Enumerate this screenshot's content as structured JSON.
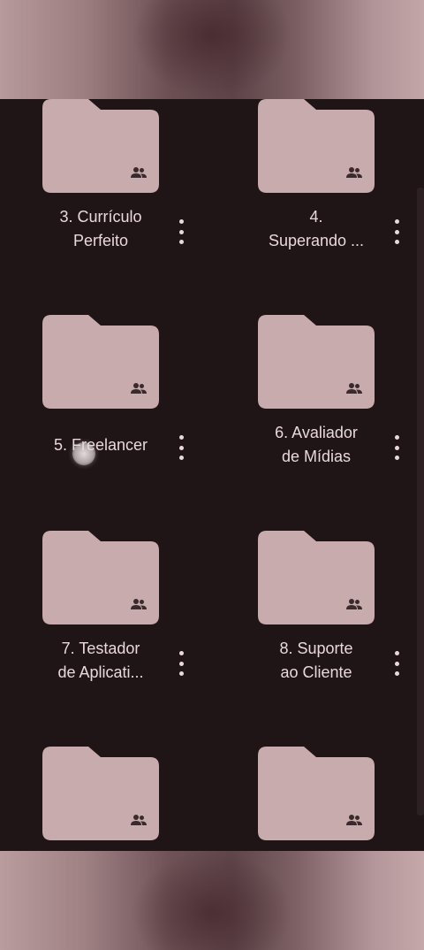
{
  "folder_color": "#c8acad",
  "folder_icon": "shared-folder-icon",
  "more_icon": "more-vert-icon",
  "folders": [
    {
      "line1": "3. Currículo",
      "line2": "Perfeito"
    },
    {
      "line1": "4.",
      "line2": "Superando ..."
    },
    {
      "line1": "5. Freelancer",
      "line2": ""
    },
    {
      "line1": "6. Avaliador",
      "line2": "de Mídias"
    },
    {
      "line1": "7. Testador",
      "line2": "de Aplicati..."
    },
    {
      "line1": "8. Suporte",
      "line2": "ao Cliente"
    },
    {
      "line1": "",
      "line2": ""
    },
    {
      "line1": "",
      "line2": ""
    }
  ]
}
